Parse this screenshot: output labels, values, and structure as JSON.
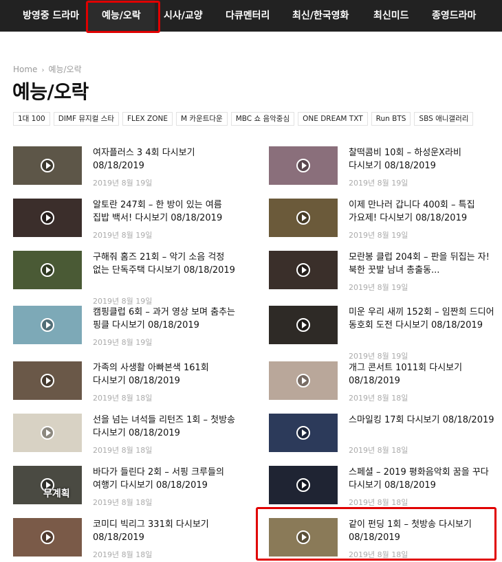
{
  "nav": {
    "items": [
      {
        "label": "방영중 드라마",
        "active": false
      },
      {
        "label": "예능/오락",
        "active": true
      },
      {
        "label": "시사/교양",
        "active": false
      },
      {
        "label": "다큐멘터리",
        "active": false
      },
      {
        "label": "최신/한국영화",
        "active": false
      },
      {
        "label": "최신미드",
        "active": false
      },
      {
        "label": "종영드라마",
        "active": false
      }
    ]
  },
  "breadcrumb": {
    "home": "Home",
    "separator": "›",
    "current": "예능/오락"
  },
  "page_title": "예능/오락",
  "tags": [
    "1대 100",
    "DIMF 뮤지컬 스타",
    "FLEX ZONE",
    "M 카운트다운",
    "MBC 쇼 음악중심",
    "ONE DREAM TXT",
    "Run BTS",
    "SBS 애니갤러리"
  ],
  "posts": [
    {
      "title": "여자플러스 3 4회 다시보기 08/18/2019",
      "date": "2019년 8월 19일",
      "thumb_color": "#5d5648"
    },
    {
      "title": "찰떡콤비 10회 – 하성운X라비 다시보기 08/18/2019",
      "date": "2019년 8월 19일",
      "thumb_color": "#8a6f7b"
    },
    {
      "title": "알토란 247회 – 한 방이 있는 여름 집밥 백서! 다시보기 08/18/2019",
      "date": "2019년 8월 19일",
      "thumb_color": "#3b2e2b"
    },
    {
      "title": "이제 만나러 갑니다 400회 – 특집 가요제! 다시보기 08/18/2019",
      "date": "2019년 8월 19일",
      "thumb_color": "#6b5a3a"
    },
    {
      "title": "구해줘 홈즈 21회 – 악기 소음 걱정 없는 단독주택 다시보기 08/18/2019",
      "date": "2019년 8월 19일",
      "thumb_color": "#4a5a35"
    },
    {
      "title": "모란봉 클럽 204회 – 판을 뒤집는 자! 북한 꿋발 남녀 총출동...",
      "date": "2019년 8월 19일",
      "thumb_color": "#3a2f2a"
    },
    {
      "title": "캠핑클럽 6회 – 과거 영상 보며 춤추는 핑클 다시보기 08/18/2019",
      "date": "2019년 8월 19일",
      "thumb_color": "#7da9b7"
    },
    {
      "title": "미운 우리 새끼 152회 – 임짠희 드디어 동호회 도전 다시보기 08/18/2019",
      "date": "2019년 8월 19일",
      "thumb_color": "#2e2a26"
    },
    {
      "title": "가족의 사생활 아빠본색 161회 다시보기 08/18/2019",
      "date": "2019년 8월 18일",
      "thumb_color": "#6a5848"
    },
    {
      "title": "개그 콘서트 1011회 다시보기 08/18/2019",
      "date": "2019년 8월 18일",
      "thumb_color": "#b9a79a"
    },
    {
      "title": "선을 넘는 녀석들 리턴즈 1회 – 첫방송 다시보기 08/18/2019",
      "date": "2019년 8월 18일",
      "thumb_color": "#d8d2c4"
    },
    {
      "title": "스마일킹 17회 다시보기 08/18/2019",
      "date": "2019년 8월 18일",
      "thumb_color": "#2c3a5a"
    },
    {
      "title": "바다가 들린다 2회 – 서핑 크루들의 여행기 다시보기 08/18/2019",
      "date": "2019년 8월 18일",
      "thumb_color": "#4a4a42",
      "thumb_caption": "무계획"
    },
    {
      "title": "스페셜 – 2019 평화음악회 꿈을 꾸다 다시보기 08/18/2019",
      "date": "2019년 8월 18일",
      "thumb_color": "#1f2433"
    },
    {
      "title": "코미디 빅리그 331회 다시보기 08/18/2019",
      "date": "2019년 8월 18일",
      "thumb_color": "#7a5a48"
    },
    {
      "title": "같이 펀딩 1회 – 첫방송 다시보기 08/18/2019",
      "date": "2019년 8월 18일",
      "thumb_color": "#8a7a58"
    }
  ],
  "colors": {
    "nav_bg": "#222222",
    "highlight": "#e00000",
    "date_text": "#aaaaaa"
  }
}
